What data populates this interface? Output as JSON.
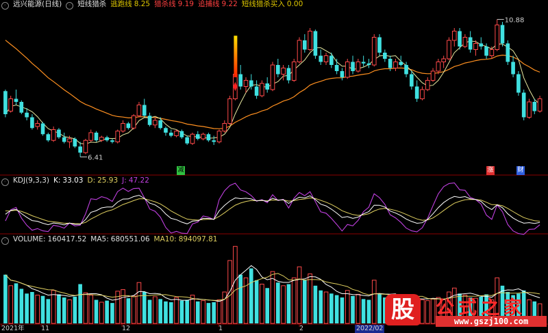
{
  "panel1": {
    "title": "远兴能源(日线)",
    "indicator": "短线猎杀",
    "items": [
      {
        "label": "逃跑线",
        "value": "8.25",
        "color": "#e0c800"
      },
      {
        "label": "猎杀线",
        "value": "9.19",
        "color": "#ff4040"
      },
      {
        "label": "追捕线",
        "value": "9.22",
        "color": "#ff4040"
      },
      {
        "label": "短线猎杀买入",
        "value": "0.00",
        "color": "#e0c800"
      }
    ],
    "high_label": "10.88",
    "low_label": "6.41",
    "badges": [
      "减",
      "涨",
      "财"
    ]
  },
  "panel2": {
    "title": "KDJ(9,3,3)",
    "k_label": "K:",
    "k": "33.03",
    "d_label": "D:",
    "d": "25.93",
    "j_label": "J:",
    "j": "47.22"
  },
  "panel3": {
    "title": "VOLUME:",
    "volume": "160417.52",
    "ma5_label": "MA5:",
    "ma5": "680551.06",
    "ma10_label": "MA10:",
    "ma10": "894097.81"
  },
  "x_labels": [
    "2021年",
    "11",
    "12",
    "1",
    "2",
    "2022/02"
  ],
  "logo": {
    "glyph": "股",
    "name": "公式之家",
    "url": "www.gszj100.com"
  },
  "colors": {
    "up": "#ff4a4a",
    "down": "#40e0e0",
    "ma_long": "#ff9020",
    "ma_short": "#e8e8a0",
    "k": "#ffffff",
    "d": "#e0d060",
    "j": "#c040e0",
    "grid": "#8b0000"
  },
  "chart_data": [
    {
      "type": "candlestick",
      "title": "远兴能源(日线)",
      "ylim": [
        6.0,
        11.2
      ],
      "annotations": [
        {
          "text": "10.88",
          "value": 10.88
        },
        {
          "text": "6.41",
          "value": 6.41
        }
      ],
      "ohlc": [
        [
          8.55,
          8.6,
          7.7,
          7.8
        ],
        [
          7.9,
          8.4,
          7.85,
          8.3
        ],
        [
          8.3,
          8.6,
          8.1,
          8.2
        ],
        [
          8.2,
          8.25,
          7.8,
          7.85
        ],
        [
          7.85,
          8.0,
          7.6,
          7.7
        ],
        [
          7.7,
          7.8,
          7.3,
          7.35
        ],
        [
          7.4,
          7.6,
          7.3,
          7.5
        ],
        [
          7.5,
          7.55,
          7.1,
          7.15
        ],
        [
          7.15,
          7.2,
          6.9,
          6.95
        ],
        [
          6.95,
          7.4,
          6.9,
          7.3
        ],
        [
          7.3,
          7.35,
          7.0,
          7.05
        ],
        [
          7.05,
          7.2,
          6.85,
          6.9
        ],
        [
          6.9,
          7.1,
          6.7,
          7.0
        ],
        [
          7.0,
          7.05,
          6.7,
          6.75
        ],
        [
          6.75,
          6.9,
          6.41,
          6.55
        ],
        [
          6.55,
          7.0,
          6.5,
          6.95
        ],
        [
          6.95,
          7.3,
          6.9,
          7.2
        ],
        [
          7.2,
          7.25,
          6.9,
          6.95
        ],
        [
          6.95,
          7.1,
          6.9,
          7.05
        ],
        [
          7.05,
          7.1,
          6.9,
          6.95
        ],
        [
          6.95,
          7.0,
          6.85,
          6.9
        ],
        [
          6.9,
          7.3,
          6.85,
          7.25
        ],
        [
          7.25,
          7.6,
          7.2,
          7.5
        ],
        [
          7.5,
          7.55,
          7.3,
          7.35
        ],
        [
          7.35,
          7.8,
          7.3,
          7.75
        ],
        [
          7.75,
          8.2,
          7.7,
          8.1
        ],
        [
          8.1,
          8.3,
          7.7,
          7.75
        ],
        [
          7.75,
          7.85,
          7.4,
          7.45
        ],
        [
          7.45,
          7.7,
          7.35,
          7.6
        ],
        [
          7.6,
          7.7,
          7.3,
          7.35
        ],
        [
          7.35,
          7.4,
          7.1,
          7.2
        ],
        [
          7.2,
          7.3,
          7.05,
          7.1
        ],
        [
          7.1,
          7.3,
          7.05,
          7.25
        ],
        [
          7.25,
          7.3,
          7.0,
          7.05
        ],
        [
          7.05,
          7.1,
          6.8,
          6.85
        ],
        [
          6.85,
          7.2,
          6.8,
          7.15
        ],
        [
          7.15,
          7.25,
          6.95,
          7.0
        ],
        [
          7.0,
          7.2,
          6.95,
          7.15
        ],
        [
          7.15,
          7.2,
          6.9,
          6.95
        ],
        [
          6.95,
          7.1,
          6.8,
          6.9
        ],
        [
          6.9,
          7.3,
          6.85,
          7.25
        ],
        [
          7.25,
          7.6,
          7.2,
          7.5
        ],
        [
          7.5,
          8.4,
          7.45,
          8.3
        ],
        [
          8.3,
          9.2,
          8.25,
          9.1
        ],
        [
          9.1,
          9.4,
          8.6,
          8.7
        ],
        [
          8.7,
          9.0,
          8.5,
          8.9
        ],
        [
          8.9,
          9.1,
          8.6,
          8.7
        ],
        [
          8.7,
          8.9,
          8.3,
          8.4
        ],
        [
          8.4,
          8.9,
          8.35,
          8.8
        ],
        [
          8.8,
          9.0,
          8.5,
          8.6
        ],
        [
          8.6,
          9.5,
          8.55,
          9.4
        ],
        [
          9.4,
          9.6,
          9.0,
          9.1
        ],
        [
          9.1,
          9.4,
          8.9,
          9.3
        ],
        [
          9.3,
          9.4,
          8.8,
          8.9
        ],
        [
          8.9,
          9.6,
          8.85,
          9.5
        ],
        [
          9.5,
          10.3,
          9.45,
          10.2
        ],
        [
          10.2,
          10.4,
          9.8,
          9.9
        ],
        [
          9.9,
          10.6,
          9.85,
          10.5
        ],
        [
          10.5,
          10.55,
          9.6,
          9.7
        ],
        [
          9.7,
          9.9,
          9.4,
          9.5
        ],
        [
          9.5,
          9.8,
          9.4,
          9.7
        ],
        [
          9.7,
          9.8,
          9.3,
          9.4
        ],
        [
          9.4,
          9.6,
          9.1,
          9.2
        ],
        [
          9.2,
          9.3,
          8.9,
          9.0
        ],
        [
          9.0,
          9.6,
          8.95,
          9.5
        ],
        [
          9.5,
          9.7,
          9.1,
          9.2
        ],
        [
          9.2,
          9.6,
          9.15,
          9.5
        ],
        [
          9.5,
          9.7,
          9.35,
          9.45
        ],
        [
          9.45,
          9.6,
          9.3,
          9.4
        ],
        [
          9.4,
          10.4,
          9.35,
          10.3
        ],
        [
          10.3,
          10.4,
          9.7,
          9.8
        ],
        [
          9.8,
          9.9,
          9.5,
          9.6
        ],
        [
          9.6,
          9.7,
          9.2,
          9.3
        ],
        [
          9.3,
          9.6,
          9.2,
          9.5
        ],
        [
          9.5,
          9.7,
          9.35,
          9.4
        ],
        [
          9.4,
          9.5,
          9.0,
          9.1
        ],
        [
          9.1,
          9.2,
          8.6,
          8.7
        ],
        [
          8.7,
          8.9,
          8.2,
          8.3
        ],
        [
          8.3,
          8.7,
          8.25,
          8.6
        ],
        [
          8.6,
          9.0,
          8.55,
          8.9
        ],
        [
          8.9,
          9.3,
          8.85,
          9.2
        ],
        [
          9.2,
          9.6,
          9.1,
          9.5
        ],
        [
          9.5,
          9.7,
          9.3,
          9.6
        ],
        [
          9.6,
          10.3,
          9.55,
          10.2
        ],
        [
          10.2,
          10.6,
          10.0,
          10.5
        ],
        [
          10.5,
          10.6,
          9.9,
          10.0
        ],
        [
          10.0,
          10.4,
          9.95,
          10.3
        ],
        [
          10.3,
          10.5,
          9.8,
          9.9
        ],
        [
          9.9,
          10.2,
          9.7,
          10.1
        ],
        [
          10.1,
          10.3,
          9.9,
          10.0
        ],
        [
          10.0,
          10.1,
          9.6,
          9.7
        ],
        [
          9.7,
          10.0,
          9.6,
          9.9
        ],
        [
          9.9,
          10.88,
          9.85,
          10.7
        ],
        [
          10.7,
          10.8,
          10.0,
          10.1
        ],
        [
          10.1,
          10.2,
          9.4,
          9.5
        ],
        [
          9.5,
          9.7,
          9.0,
          9.1
        ],
        [
          9.1,
          9.2,
          8.4,
          8.5
        ],
        [
          8.5,
          8.6,
          7.6,
          7.7
        ],
        [
          7.7,
          8.3,
          7.65,
          8.2
        ],
        [
          8.2,
          8.3,
          7.8,
          7.9
        ],
        [
          7.9,
          8.4,
          7.85,
          8.3
        ]
      ],
      "series": [
        {
          "name": "逃跑线",
          "color": "#e8e8a0"
        },
        {
          "name": "猎杀线",
          "color": "#ff9020"
        }
      ]
    },
    {
      "type": "line",
      "title": "KDJ(9,3,3)",
      "ylim": [
        -10,
        110
      ],
      "series": [
        {
          "name": "K"
        },
        {
          "name": "D"
        },
        {
          "name": "J"
        }
      ]
    },
    {
      "type": "bar",
      "title": "VOLUME",
      "ylim": [
        0,
        2000000
      ],
      "volume_scale": [
        0.62,
        0.48,
        0.51,
        0.44,
        0.38,
        0.4,
        0.36,
        0.35,
        0.31,
        0.42,
        0.37,
        0.33,
        0.3,
        0.34,
        0.5,
        0.39,
        0.36,
        0.3,
        0.27,
        0.29,
        0.26,
        0.41,
        0.43,
        0.32,
        0.35,
        0.52,
        0.4,
        0.3,
        0.34,
        0.31,
        0.28,
        0.27,
        0.33,
        0.29,
        0.3,
        0.36,
        0.28,
        0.29,
        0.26,
        0.27,
        0.3,
        0.4,
        0.8,
        0.98,
        0.62,
        0.58,
        0.7,
        0.55,
        0.5,
        0.45,
        0.66,
        0.52,
        0.48,
        0.5,
        0.58,
        0.72,
        0.55,
        0.63,
        0.48,
        0.42,
        0.4,
        0.38,
        0.36,
        0.33,
        0.42,
        0.35,
        0.37,
        0.31,
        0.3,
        0.55,
        0.38,
        0.33,
        0.3,
        0.32,
        0.29,
        0.27,
        0.36,
        0.34,
        0.3,
        0.29,
        0.31,
        0.33,
        0.3,
        0.4,
        0.45,
        0.38,
        0.36,
        0.33,
        0.32,
        0.34,
        0.37,
        0.3,
        0.58,
        0.48,
        0.4,
        0.36,
        0.38,
        0.42,
        0.3,
        0.28,
        0.25
      ]
    }
  ]
}
